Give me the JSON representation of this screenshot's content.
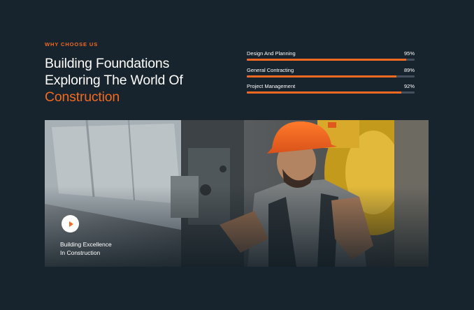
{
  "section": {
    "eyebrow": "WHY CHOOSE US",
    "heading_line1": "Building Foundations",
    "heading_line2": "Exploring The World Of",
    "heading_accent": "Construction"
  },
  "skills": [
    {
      "label": "Design And Planning",
      "value_text": "95%",
      "percent": 95
    },
    {
      "label": "General Contracting",
      "value_text": "89%",
      "percent": 89
    },
    {
      "label": "Project Management",
      "value_text": "92%",
      "percent": 92
    }
  ],
  "video": {
    "caption_line1": "Building Excellence",
    "caption_line2": "In Construction",
    "play_icon": "play-icon"
  },
  "colors": {
    "background": "#17232d",
    "accent": "#f26a21",
    "track": "#44515c"
  }
}
